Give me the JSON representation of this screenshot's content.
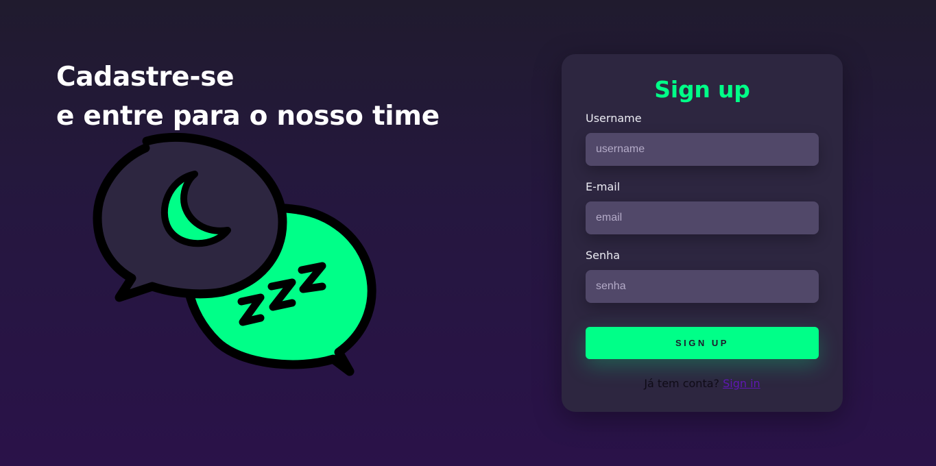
{
  "hero": {
    "line1": "Cadastre-se",
    "line2": "e entre para o nosso time",
    "illustration": {
      "icons": [
        "chat-bubble-icon",
        "moon-icon",
        "sleep-zzz-icon"
      ],
      "colors": {
        "outline": "#000000",
        "dark_bubble": "#2d2640",
        "accent": "#00ff88"
      }
    }
  },
  "form": {
    "title": "Sign up",
    "fields": [
      {
        "label": "Username",
        "placeholder": "username",
        "value": ""
      },
      {
        "label": "E-mail",
        "placeholder": "email",
        "value": ""
      },
      {
        "label": "Senha",
        "placeholder": "senha",
        "value": ""
      }
    ],
    "submit_label": "Sign up",
    "signin_prompt": "Já tem conta?",
    "signin_link": "Sign in"
  },
  "colors": {
    "accent": "#00ff88",
    "card_background": "#2d2640",
    "input_background": "#514869",
    "page_background_top": "#201b2e",
    "page_background_bottom": "#2a1249",
    "link": "#5f17b3"
  }
}
